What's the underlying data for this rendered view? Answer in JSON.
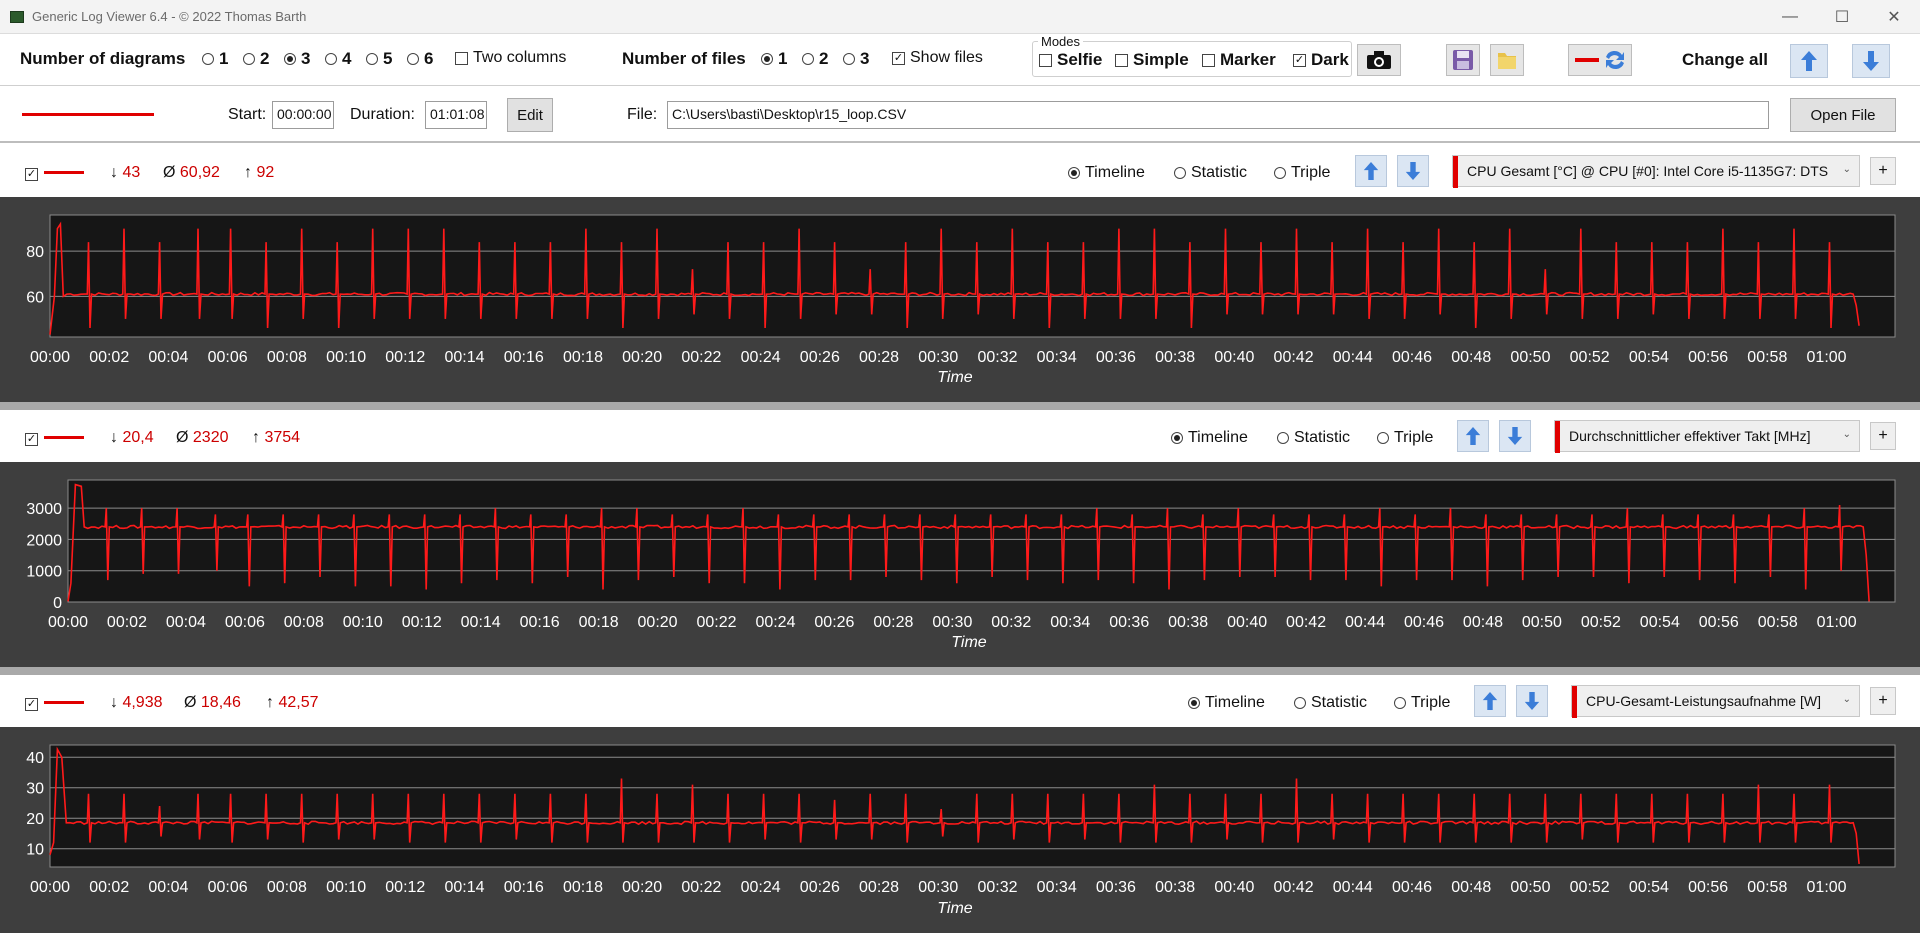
{
  "window": {
    "title": "Generic Log Viewer 6.4 - © 2022 Thomas Barth",
    "minimize": "—",
    "maximize": "☐",
    "close": "✕"
  },
  "toolbar": {
    "num_diagrams_label": "Number of diagrams",
    "diagram_options": [
      "1",
      "2",
      "3",
      "4",
      "5",
      "6"
    ],
    "diagram_selected": "3",
    "two_columns_label": "Two columns",
    "num_files_label": "Number of files",
    "file_options": [
      "1",
      "2",
      "3"
    ],
    "file_selected": "1",
    "show_files_label": "Show files",
    "modes_label": "Modes",
    "mode_selfie": "Selfie",
    "mode_simple": "Simple",
    "mode_marker": "Marker",
    "mode_dark": "Dark",
    "change_all_label": "Change all"
  },
  "file_row": {
    "start_label": "Start:",
    "start_value": "00:00:00",
    "duration_label": "Duration:",
    "duration_value": "01:01:08",
    "edit_label": "Edit",
    "file_label": "File:",
    "file_path": "C:\\Users\\basti\\Desktop\\r15_loop.CSV",
    "open_file_label": "Open File"
  },
  "view_modes": {
    "timeline": "Timeline",
    "statistic": "Statistic",
    "triple": "Triple"
  },
  "panels": [
    {
      "min_symbol": "↓",
      "min": "43",
      "avg_symbol": "Ø",
      "avg": "60,92",
      "max_symbol": "↑",
      "max": "92",
      "sensor": "CPU Gesamt [°C] @ CPU [#0]: Intel Core i5-1135G7: DTS",
      "plus": "+"
    },
    {
      "min_symbol": "↓",
      "min": "20,4",
      "avg_symbol": "Ø",
      "avg": "2320",
      "max_symbol": "↑",
      "max": "3754",
      "sensor": "Durchschnittlicher effektiver Takt [MHz]",
      "plus": "+"
    },
    {
      "min_symbol": "↓",
      "min": "4,938",
      "avg_symbol": "Ø",
      "avg": "18,46",
      "max_symbol": "↑",
      "max": "42,57",
      "sensor": "CPU-Gesamt-Leistungsaufnahme [W]",
      "plus": "+"
    }
  ],
  "chart_data": [
    {
      "type": "line",
      "xlabel": "Time",
      "ylabel": "",
      "x_ticks": [
        "00:00",
        "00:02",
        "00:04",
        "00:06",
        "00:08",
        "00:10",
        "00:12",
        "00:14",
        "00:16",
        "00:18",
        "00:20",
        "00:22",
        "00:24",
        "00:26",
        "00:28",
        "00:30",
        "00:32",
        "00:34",
        "00:36",
        "00:38",
        "00:40",
        "00:42",
        "00:44",
        "00:46",
        "00:48",
        "00:50",
        "00:52",
        "00:54",
        "00:56",
        "00:58",
        "01:00"
      ],
      "y_ticks": [
        60,
        80
      ],
      "ylim": [
        42,
        96
      ],
      "xlim_minutes": [
        0,
        61.13
      ],
      "baseline": 61,
      "start": [
        [
          0,
          43
        ],
        [
          0.15,
          60
        ],
        [
          0.25,
          90
        ],
        [
          0.35,
          92
        ],
        [
          0.45,
          60
        ]
      ],
      "spikes_minutes": [
        1.3,
        2.5,
        3.7,
        5.0,
        6.1,
        7.3,
        8.5,
        9.7,
        10.9,
        12.1,
        13.3,
        14.5,
        15.7,
        16.9,
        18.1,
        19.3,
        20.5,
        21.7,
        22.9,
        24.1,
        25.3,
        26.5,
        27.7,
        28.9,
        30.1,
        31.3,
        32.5,
        33.7,
        34.9,
        36.1,
        37.3,
        38.5,
        39.7,
        40.9,
        42.1,
        43.3,
        44.5,
        45.7,
        46.9,
        48.1,
        49.3,
        50.5,
        51.7,
        52.9,
        54.1,
        55.3,
        56.5,
        57.7,
        58.9,
        60.1
      ],
      "spike_peaks": [
        84,
        90,
        84,
        90,
        90,
        84,
        90,
        84,
        90,
        90,
        90,
        84,
        84,
        84,
        90,
        84,
        90,
        72,
        84,
        84,
        90,
        84,
        72,
        84,
        90,
        84,
        90,
        84,
        84,
        90,
        90,
        84,
        90,
        84,
        90,
        84,
        90,
        84,
        90,
        84,
        90,
        72,
        90,
        84,
        84,
        84,
        90,
        84,
        90,
        84
      ],
      "spike_dips": [
        46,
        50,
        50,
        50,
        50,
        46,
        50,
        46,
        50,
        50,
        50,
        50,
        50,
        50,
        50,
        46,
        50,
        52,
        50,
        46,
        50,
        52,
        52,
        46,
        50,
        52,
        50,
        46,
        50,
        50,
        50,
        46,
        52,
        52,
        52,
        52,
        50,
        50,
        52,
        46,
        50,
        52,
        50,
        50,
        52,
        50,
        50,
        50,
        50,
        46
      ],
      "end": [
        [
          60.9,
          61
        ],
        [
          61.0,
          56
        ],
        [
          61.1,
          47
        ]
      ]
    },
    {
      "type": "line",
      "xlabel": "Time",
      "ylabel": "",
      "x_ticks": [
        "00:00",
        "00:02",
        "00:04",
        "00:06",
        "00:08",
        "00:10",
        "00:12",
        "00:14",
        "00:16",
        "00:18",
        "00:20",
        "00:22",
        "00:24",
        "00:26",
        "00:28",
        "00:30",
        "00:32",
        "00:34",
        "00:36",
        "00:38",
        "00:40",
        "00:42",
        "00:44",
        "00:46",
        "00:48",
        "00:50",
        "00:52",
        "00:54",
        "00:56",
        "00:58",
        "01:00"
      ],
      "y_ticks": [
        0,
        1000,
        2000,
        3000
      ],
      "ylim": [
        0,
        3900
      ],
      "xlim_minutes": [
        0,
        61.13
      ],
      "baseline": 2400,
      "start": [
        [
          0,
          20
        ],
        [
          0.1,
          600
        ],
        [
          0.25,
          3754
        ],
        [
          0.45,
          3700
        ],
        [
          0.55,
          2400
        ]
      ],
      "spikes_minutes": [
        1.3,
        2.5,
        3.7,
        5.0,
        6.1,
        7.3,
        8.5,
        9.7,
        10.9,
        12.1,
        13.3,
        14.5,
        15.7,
        16.9,
        18.1,
        19.3,
        20.5,
        21.7,
        22.9,
        24.1,
        25.3,
        26.5,
        27.7,
        28.9,
        30.1,
        31.3,
        32.5,
        33.7,
        34.9,
        36.1,
        37.3,
        38.5,
        39.7,
        40.9,
        42.1,
        43.3,
        44.5,
        45.7,
        46.9,
        48.1,
        49.3,
        50.5,
        51.7,
        52.9,
        54.1,
        55.3,
        56.5,
        57.7,
        58.9,
        60.1
      ],
      "spike_peaks": [
        3000,
        3000,
        3000,
        2800,
        2800,
        2800,
        2800,
        2800,
        2800,
        2800,
        2800,
        3000,
        2800,
        2800,
        3000,
        3000,
        2800,
        2800,
        3000,
        2800,
        2800,
        2800,
        2800,
        2800,
        2800,
        2800,
        2800,
        2800,
        3000,
        2800,
        3000,
        2800,
        3000,
        2800,
        2800,
        2800,
        3000,
        2800,
        3000,
        2800,
        2800,
        2800,
        2800,
        3000,
        2800,
        2800,
        2800,
        2800,
        3000,
        3100
      ],
      "spike_dips": [
        700,
        900,
        900,
        1000,
        500,
        600,
        800,
        500,
        500,
        400,
        600,
        700,
        600,
        800,
        400,
        700,
        800,
        600,
        600,
        400,
        700,
        700,
        800,
        700,
        600,
        800,
        700,
        600,
        700,
        600,
        400,
        700,
        800,
        800,
        700,
        700,
        500,
        700,
        700,
        500,
        700,
        800,
        800,
        600,
        800,
        700,
        600,
        800,
        400,
        1000
      ],
      "end": [
        [
          60.9,
          2400
        ],
        [
          61.0,
          1500
        ],
        [
          61.1,
          20
        ]
      ]
    },
    {
      "type": "line",
      "xlabel": "Time",
      "ylabel": "",
      "x_ticks": [
        "00:00",
        "00:02",
        "00:04",
        "00:06",
        "00:08",
        "00:10",
        "00:12",
        "00:14",
        "00:16",
        "00:18",
        "00:20",
        "00:22",
        "00:24",
        "00:26",
        "00:28",
        "00:30",
        "00:32",
        "00:34",
        "00:36",
        "00:38",
        "00:40",
        "00:42",
        "00:44",
        "00:46",
        "00:48",
        "00:50",
        "00:52",
        "00:54",
        "00:56",
        "00:58",
        "01:00"
      ],
      "y_ticks": [
        10,
        20,
        30,
        40
      ],
      "ylim": [
        4,
        44
      ],
      "xlim_minutes": [
        0,
        61.13
      ],
      "baseline": 18.5,
      "start": [
        [
          0,
          8
        ],
        [
          0.12,
          12
        ],
        [
          0.25,
          42.57
        ],
        [
          0.4,
          40
        ],
        [
          0.55,
          18.5
        ]
      ],
      "spikes_minutes": [
        1.3,
        2.5,
        3.7,
        5.0,
        6.1,
        7.3,
        8.5,
        9.7,
        10.9,
        12.1,
        13.3,
        14.5,
        15.7,
        16.9,
        18.1,
        19.3,
        20.5,
        21.7,
        22.9,
        24.1,
        25.3,
        26.5,
        27.7,
        28.9,
        30.1,
        31.3,
        32.5,
        33.7,
        34.9,
        36.1,
        37.3,
        38.5,
        39.7,
        40.9,
        42.1,
        43.3,
        44.5,
        45.7,
        46.9,
        48.1,
        49.3,
        50.5,
        51.7,
        52.9,
        54.1,
        55.3,
        56.5,
        57.7,
        58.9,
        60.1
      ],
      "spike_peaks": [
        28,
        28,
        24,
        28,
        28,
        28,
        28,
        28,
        28,
        28,
        28,
        28,
        28,
        28,
        28,
        33,
        28,
        31,
        28,
        28,
        28,
        26,
        28,
        28,
        23,
        28,
        28,
        28,
        28,
        28,
        31,
        28,
        28,
        28,
        33,
        28,
        28,
        28,
        28,
        28,
        28,
        28,
        28,
        28,
        28,
        28,
        28,
        31,
        28,
        31
      ],
      "spike_dips": [
        12,
        12,
        14,
        13,
        12,
        13,
        12,
        13,
        13,
        12,
        12,
        12,
        13,
        12,
        12,
        12,
        12,
        12,
        12,
        13,
        12,
        13,
        13,
        12,
        14,
        12,
        13,
        12,
        13,
        12,
        12,
        12,
        13,
        12,
        12,
        13,
        12,
        12,
        12,
        12,
        12,
        12,
        13,
        12,
        12,
        12,
        12,
        12,
        12,
        12
      ],
      "end": [
        [
          60.9,
          18.5
        ],
        [
          61.0,
          15
        ],
        [
          61.1,
          5
        ]
      ]
    }
  ]
}
